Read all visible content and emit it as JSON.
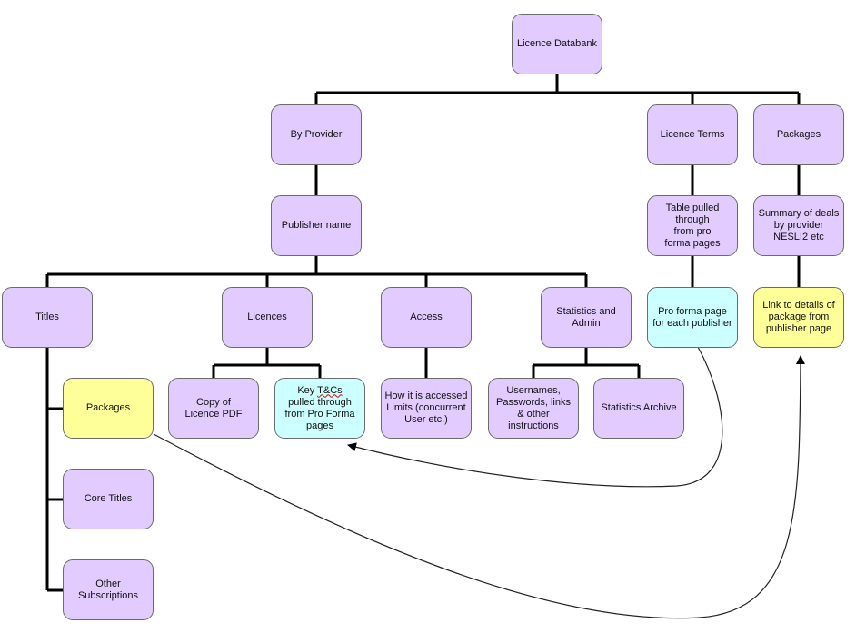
{
  "colors": {
    "purple": "#e2ccff",
    "cyan": "#ccffff",
    "yellow": "#ffff99",
    "border": "#6b6b6b",
    "connector": "#000000"
  },
  "nodes": {
    "root": "Licence Databank",
    "by_provider": "By Provider",
    "licence_terms": "Licence Terms",
    "packages_top": "Packages",
    "publisher_name": "Publisher name",
    "table_pulled": "Table pulled through\nfrom pro\nforma pages",
    "summary_deals": "Summary of deals\nby provider\nNESLI2 etc",
    "titles": "Titles",
    "licences": "Licences",
    "access": "Access",
    "stats_admin": "Statistics and\nAdmin",
    "pro_forma": "Pro forma page\nfor each publisher",
    "link_details": "Link to details of\npackage from\npublisher page",
    "packages": "Packages",
    "copy_pdf": "Copy of\nLicence PDF",
    "key_tcs_prefix": "Key ",
    "key_tcs_word": "T&Cs",
    "key_tcs_rest": "pulled through\nfrom Pro Forma\npages",
    "how_accessed": "How it is accessed\nLimits (concurrent\nUser etc.)",
    "usernames": "Usernames,\nPasswords, links\n& other\ninstructions",
    "stats_archive": "Statistics Archive",
    "core_titles": "Core Titles",
    "other_subs": "Other\nSubscriptions"
  }
}
